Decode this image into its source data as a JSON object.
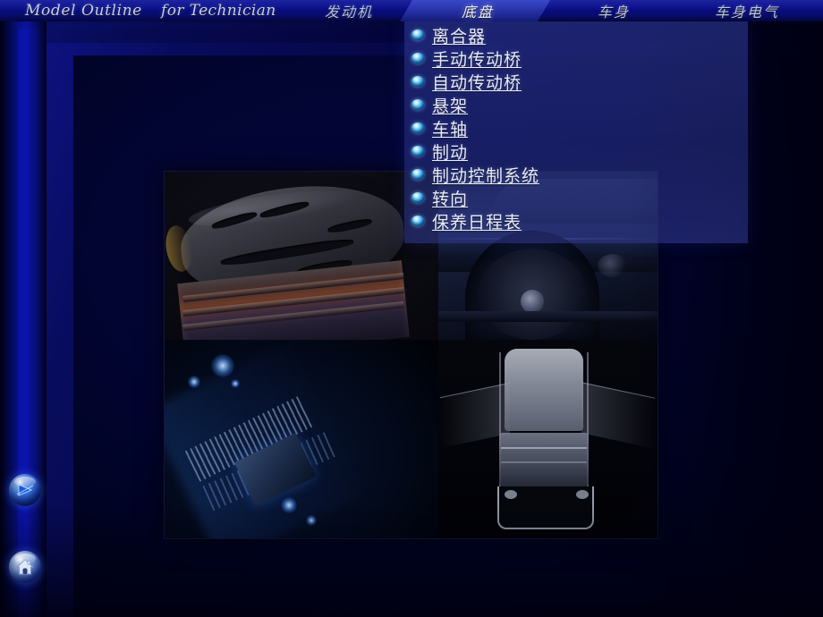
{
  "header": {
    "title_main": "Model Outline",
    "title_sub": "for Technician",
    "tabs": [
      {
        "label": "发动机",
        "active": false
      },
      {
        "label": "底盘",
        "active": true
      },
      {
        "label": "车身",
        "active": false
      },
      {
        "label": "车身电气",
        "active": false
      }
    ]
  },
  "menu": {
    "items": [
      {
        "label": "离合器",
        "bullet": "sphere-bullet-icon"
      },
      {
        "label": "手动传动桥",
        "bullet": "sphere-bullet-icon"
      },
      {
        "label": "自动传动桥",
        "bullet": "sphere-bullet-icon"
      },
      {
        "label": "悬架",
        "bullet": "sphere-bullet-icon"
      },
      {
        "label": "车轴",
        "bullet": "sphere-bullet-icon"
      },
      {
        "label": "制动",
        "bullet": "sphere-bullet-icon"
      },
      {
        "label": "制动控制系统",
        "bullet": "sphere-bullet-icon"
      },
      {
        "label": "转向",
        "bullet": "sphere-bullet-icon"
      },
      {
        "label": "保养日程表",
        "bullet": "sphere-bullet-icon"
      }
    ]
  },
  "nav": {
    "next_icon": "next-arrow-icon",
    "home_icon": "home-icon"
  },
  "collage": {
    "quadrants": [
      {
        "name": "piston-photo"
      },
      {
        "name": "wheel-photo"
      },
      {
        "name": "circuit-board-photo"
      },
      {
        "name": "car-frame-photo"
      }
    ]
  },
  "colors": {
    "bar_blue": "#0a0e86",
    "tab_highlight": "#2b36ae",
    "panel_overlay": "#2d3796",
    "text_light": "#e8ecff",
    "bullet_cyan": "#41b4ef"
  }
}
